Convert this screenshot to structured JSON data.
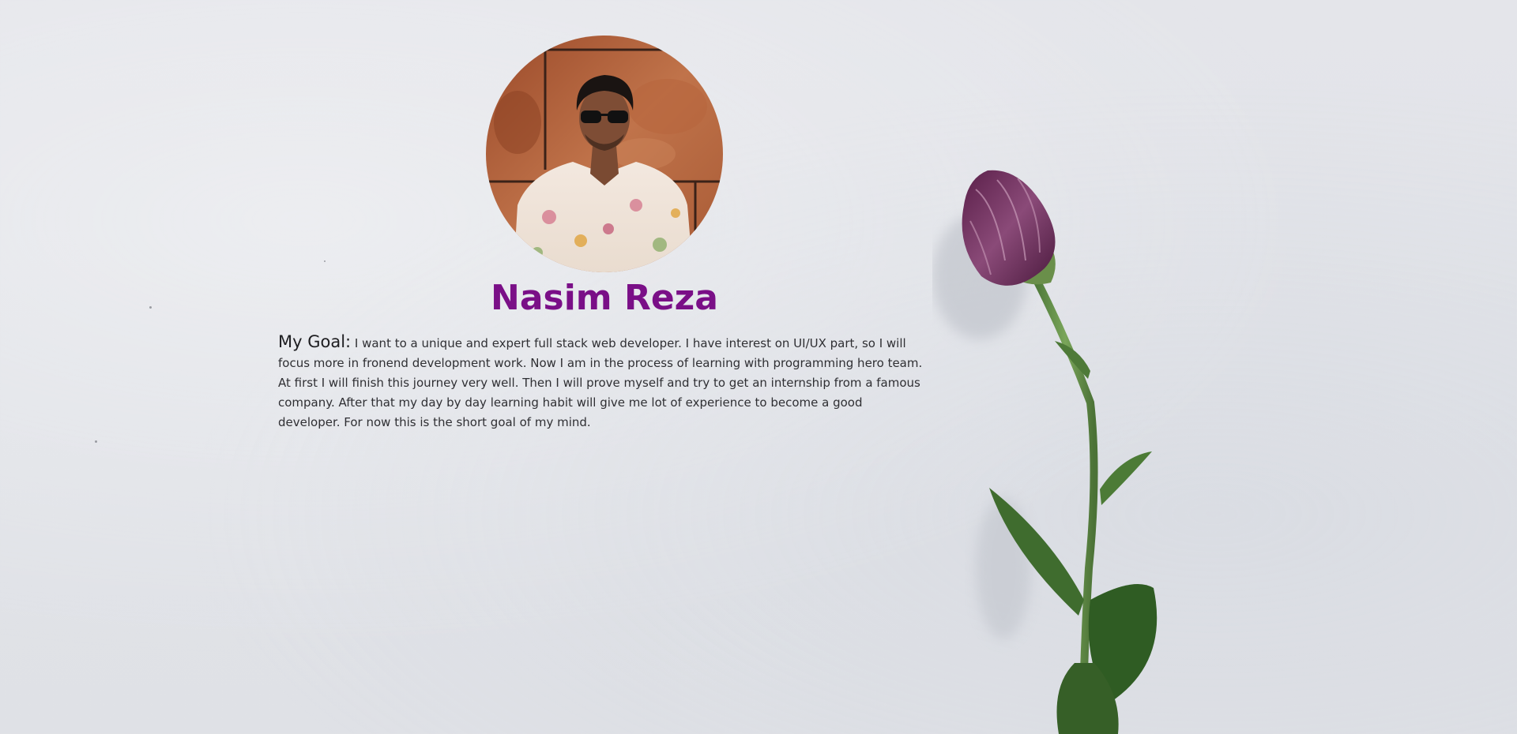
{
  "profile": {
    "name": "Nasim Reza",
    "photo_alt": "profile-photo"
  },
  "goal": {
    "label": "My Goal:",
    "text": "I want to a unique and expert full stack web developer. I have interest on UI/UX part, so I will focus more in fronend development work. Now I am in the process of learning with programming hero team. At first I will finish this journey very well. Then I will prove myself and try to get an internship from a famous company. After that my day by day learning habit will give me lot of experience to become a good developer. For now this is the short goal of my mind."
  },
  "colors": {
    "name": "#7a0f87",
    "background": "#e2e3e8"
  },
  "decoration": {
    "flower_icon": "flower-bud-icon"
  }
}
